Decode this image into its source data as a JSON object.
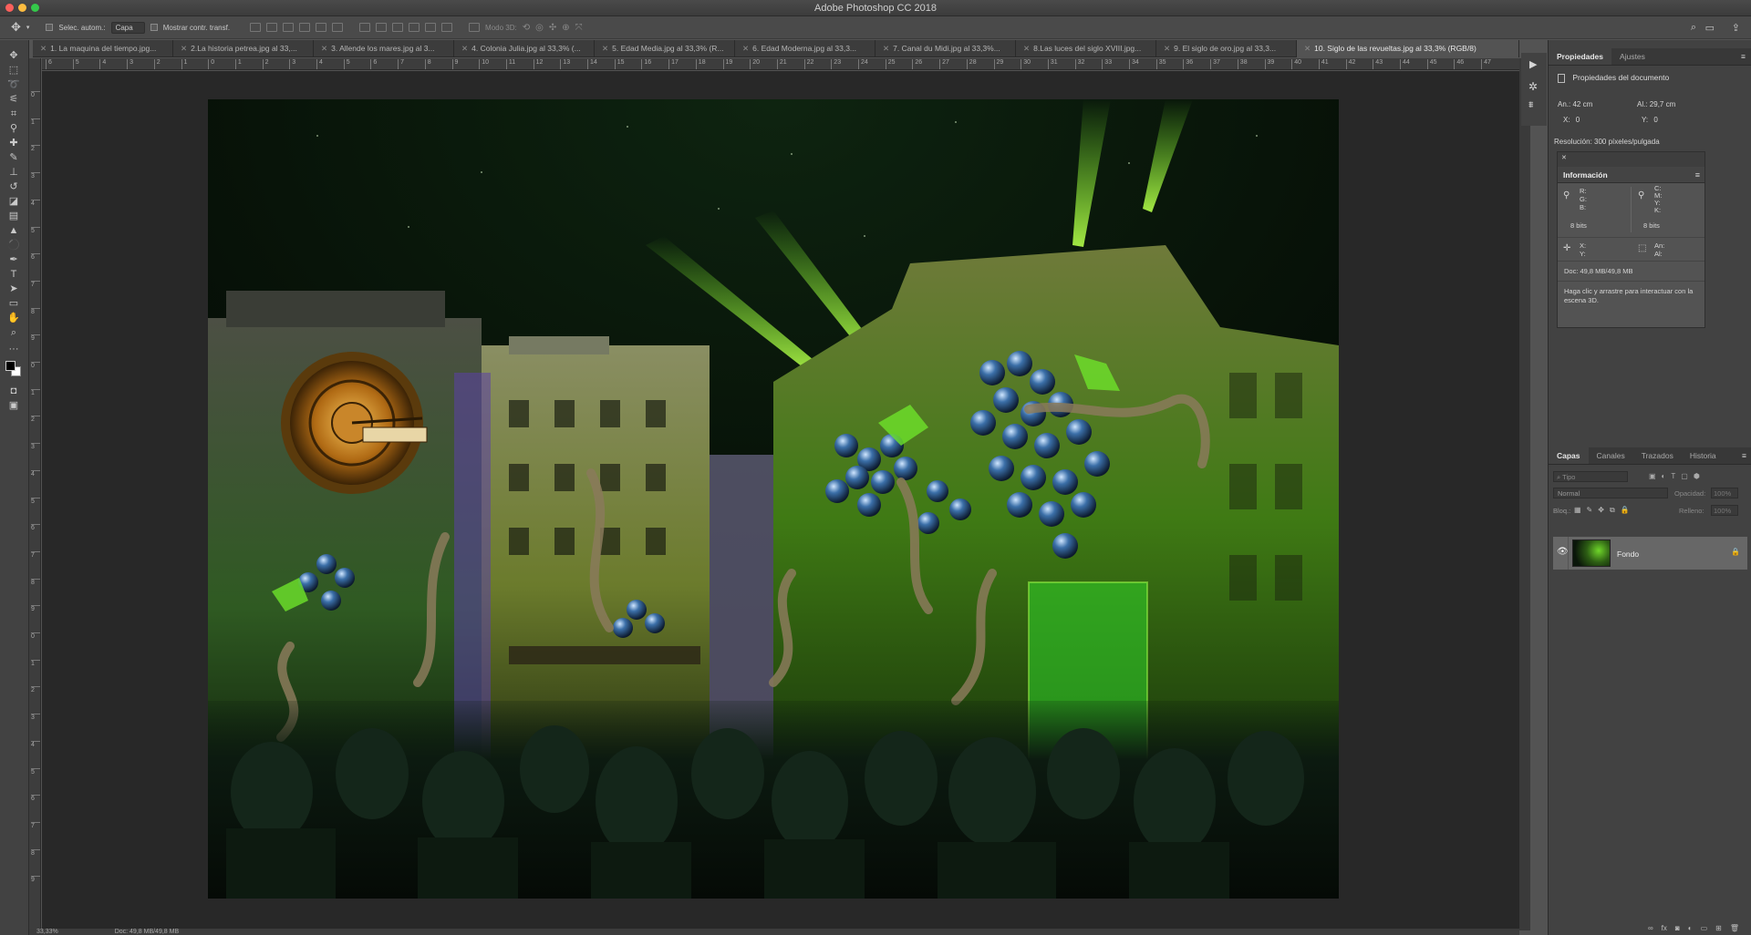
{
  "app": {
    "title": "Adobe Photoshop CC 2018"
  },
  "options_bar": {
    "auto_select_label": "Selec. autom.:",
    "auto_select_value": "Capa",
    "show_transform_label": "Mostrar contr. transf.",
    "mode_3d_label": "Modo 3D:"
  },
  "tabs": [
    {
      "label": "1. La maquina del tiempo.jpg..."
    },
    {
      "label": "2.La historia petrea.jpg al 33,..."
    },
    {
      "label": "3. Allende los mares.jpg al 3..."
    },
    {
      "label": "4. Colonia Julia.jpg al 33,3% (..."
    },
    {
      "label": "5. Edad Media.jpg al 33,3% (R..."
    },
    {
      "label": "6. Edad Moderna.jpg al 33,3..."
    },
    {
      "label": "7. Canal du Midi.jpg al 33,3%..."
    },
    {
      "label": "8.Las luces del siglo XVIII.jpg..."
    },
    {
      "label": "9. El siglo de oro.jpg al 33,3..."
    },
    {
      "label": "10. Siglo de las revueltas.jpg al 33,3% (RGB/8)"
    }
  ],
  "ruler_top_labels": [
    "6",
    "5",
    "4",
    "3",
    "2",
    "1",
    "0",
    "1",
    "2",
    "3",
    "4",
    "5",
    "6",
    "7",
    "8",
    "9",
    "10",
    "11",
    "12",
    "13",
    "14",
    "15",
    "16",
    "17",
    "18",
    "19",
    "20",
    "21",
    "22",
    "23",
    "24",
    "25",
    "26",
    "27",
    "28",
    "29",
    "30",
    "31",
    "32",
    "33",
    "34",
    "35",
    "36",
    "37",
    "38",
    "39",
    "40",
    "41",
    "42",
    "43",
    "44",
    "45",
    "46",
    "47"
  ],
  "ruler_left_labels": [
    "0",
    "1",
    "2",
    "3",
    "4",
    "5",
    "6",
    "7",
    "8",
    "9",
    "0",
    "1",
    "2",
    "3",
    "4",
    "5",
    "6",
    "7",
    "8",
    "9",
    "0",
    "1",
    "2",
    "3",
    "4",
    "5",
    "6",
    "7",
    "8",
    "9"
  ],
  "status": {
    "zoom": "33,33%",
    "doc": "Doc: 49,8 MB/49,8 MB"
  },
  "properties_panel": {
    "tab_properties": "Propiedades",
    "tab_adjustments": "Ajustes",
    "header": "Propiedades del documento",
    "width_label": "An.:",
    "width_value": "42 cm",
    "height_label": "Al.:",
    "height_value": "29,7 cm",
    "x_label": "X:",
    "x_value": "0",
    "y_label": "Y:",
    "y_value": "0",
    "resolution": "Resolución: 300 píxeles/pulgada"
  },
  "info_panel": {
    "title": "Información",
    "rgb_labels": "R:\nG:\nB:",
    "cmyk_labels": "C:\nM:\nY:\nK:",
    "bits_left": "8 bits",
    "bits_right": "8 bits",
    "xy_labels": "X:\nY:",
    "wh_labels": "An:\nAl:",
    "doc": "Doc: 49,8 MB/49,8 MB",
    "hint": "Haga clic y arrastre para interactuar con la escena 3D."
  },
  "layers_panel": {
    "tabs": [
      "Capas",
      "Canales",
      "Trazados",
      "Historia"
    ],
    "filter_placeholder": "Tipo",
    "blend_mode": "Normal",
    "opacity_label": "Opacidad:",
    "opacity_value": "100%",
    "lock_label": "Bloq.:",
    "fill_label": "Relleno:",
    "fill_value": "100%",
    "layer_name": "Fondo"
  },
  "colors": {
    "ui_dark": "#424242",
    "canvas_bg": "#282828",
    "accent_green": "#6fd62a"
  }
}
